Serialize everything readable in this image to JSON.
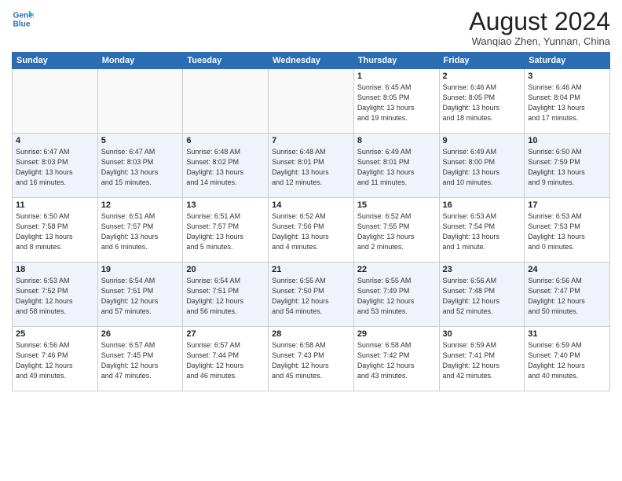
{
  "header": {
    "logo_line1": "General",
    "logo_line2": "Blue",
    "month": "August 2024",
    "location": "Wanqiao Zhen, Yunnan, China"
  },
  "weekdays": [
    "Sunday",
    "Monday",
    "Tuesday",
    "Wednesday",
    "Thursday",
    "Friday",
    "Saturday"
  ],
  "weeks": [
    [
      {
        "day": "",
        "info": ""
      },
      {
        "day": "",
        "info": ""
      },
      {
        "day": "",
        "info": ""
      },
      {
        "day": "",
        "info": ""
      },
      {
        "day": "1",
        "info": "Sunrise: 6:45 AM\nSunset: 8:05 PM\nDaylight: 13 hours\nand 19 minutes."
      },
      {
        "day": "2",
        "info": "Sunrise: 6:46 AM\nSunset: 8:05 PM\nDaylight: 13 hours\nand 18 minutes."
      },
      {
        "day": "3",
        "info": "Sunrise: 6:46 AM\nSunset: 8:04 PM\nDaylight: 13 hours\nand 17 minutes."
      }
    ],
    [
      {
        "day": "4",
        "info": "Sunrise: 6:47 AM\nSunset: 8:03 PM\nDaylight: 13 hours\nand 16 minutes."
      },
      {
        "day": "5",
        "info": "Sunrise: 6:47 AM\nSunset: 8:03 PM\nDaylight: 13 hours\nand 15 minutes."
      },
      {
        "day": "6",
        "info": "Sunrise: 6:48 AM\nSunset: 8:02 PM\nDaylight: 13 hours\nand 14 minutes."
      },
      {
        "day": "7",
        "info": "Sunrise: 6:48 AM\nSunset: 8:01 PM\nDaylight: 13 hours\nand 12 minutes."
      },
      {
        "day": "8",
        "info": "Sunrise: 6:49 AM\nSunset: 8:01 PM\nDaylight: 13 hours\nand 11 minutes."
      },
      {
        "day": "9",
        "info": "Sunrise: 6:49 AM\nSunset: 8:00 PM\nDaylight: 13 hours\nand 10 minutes."
      },
      {
        "day": "10",
        "info": "Sunrise: 6:50 AM\nSunset: 7:59 PM\nDaylight: 13 hours\nand 9 minutes."
      }
    ],
    [
      {
        "day": "11",
        "info": "Sunrise: 6:50 AM\nSunset: 7:58 PM\nDaylight: 13 hours\nand 8 minutes."
      },
      {
        "day": "12",
        "info": "Sunrise: 6:51 AM\nSunset: 7:57 PM\nDaylight: 13 hours\nand 6 minutes."
      },
      {
        "day": "13",
        "info": "Sunrise: 6:51 AM\nSunset: 7:57 PM\nDaylight: 13 hours\nand 5 minutes."
      },
      {
        "day": "14",
        "info": "Sunrise: 6:52 AM\nSunset: 7:56 PM\nDaylight: 13 hours\nand 4 minutes."
      },
      {
        "day": "15",
        "info": "Sunrise: 6:52 AM\nSunset: 7:55 PM\nDaylight: 13 hours\nand 2 minutes."
      },
      {
        "day": "16",
        "info": "Sunrise: 6:53 AM\nSunset: 7:54 PM\nDaylight: 13 hours\nand 1 minute."
      },
      {
        "day": "17",
        "info": "Sunrise: 6:53 AM\nSunset: 7:53 PM\nDaylight: 13 hours\nand 0 minutes."
      }
    ],
    [
      {
        "day": "18",
        "info": "Sunrise: 6:53 AM\nSunset: 7:52 PM\nDaylight: 12 hours\nand 58 minutes."
      },
      {
        "day": "19",
        "info": "Sunrise: 6:54 AM\nSunset: 7:51 PM\nDaylight: 12 hours\nand 57 minutes."
      },
      {
        "day": "20",
        "info": "Sunrise: 6:54 AM\nSunset: 7:51 PM\nDaylight: 12 hours\nand 56 minutes."
      },
      {
        "day": "21",
        "info": "Sunrise: 6:55 AM\nSunset: 7:50 PM\nDaylight: 12 hours\nand 54 minutes."
      },
      {
        "day": "22",
        "info": "Sunrise: 6:55 AM\nSunset: 7:49 PM\nDaylight: 12 hours\nand 53 minutes."
      },
      {
        "day": "23",
        "info": "Sunrise: 6:56 AM\nSunset: 7:48 PM\nDaylight: 12 hours\nand 52 minutes."
      },
      {
        "day": "24",
        "info": "Sunrise: 6:56 AM\nSunset: 7:47 PM\nDaylight: 12 hours\nand 50 minutes."
      }
    ],
    [
      {
        "day": "25",
        "info": "Sunrise: 6:56 AM\nSunset: 7:46 PM\nDaylight: 12 hours\nand 49 minutes."
      },
      {
        "day": "26",
        "info": "Sunrise: 6:57 AM\nSunset: 7:45 PM\nDaylight: 12 hours\nand 47 minutes."
      },
      {
        "day": "27",
        "info": "Sunrise: 6:57 AM\nSunset: 7:44 PM\nDaylight: 12 hours\nand 46 minutes."
      },
      {
        "day": "28",
        "info": "Sunrise: 6:58 AM\nSunset: 7:43 PM\nDaylight: 12 hours\nand 45 minutes."
      },
      {
        "day": "29",
        "info": "Sunrise: 6:58 AM\nSunset: 7:42 PM\nDaylight: 12 hours\nand 43 minutes."
      },
      {
        "day": "30",
        "info": "Sunrise: 6:59 AM\nSunset: 7:41 PM\nDaylight: 12 hours\nand 42 minutes."
      },
      {
        "day": "31",
        "info": "Sunrise: 6:59 AM\nSunset: 7:40 PM\nDaylight: 12 hours\nand 40 minutes."
      }
    ]
  ]
}
